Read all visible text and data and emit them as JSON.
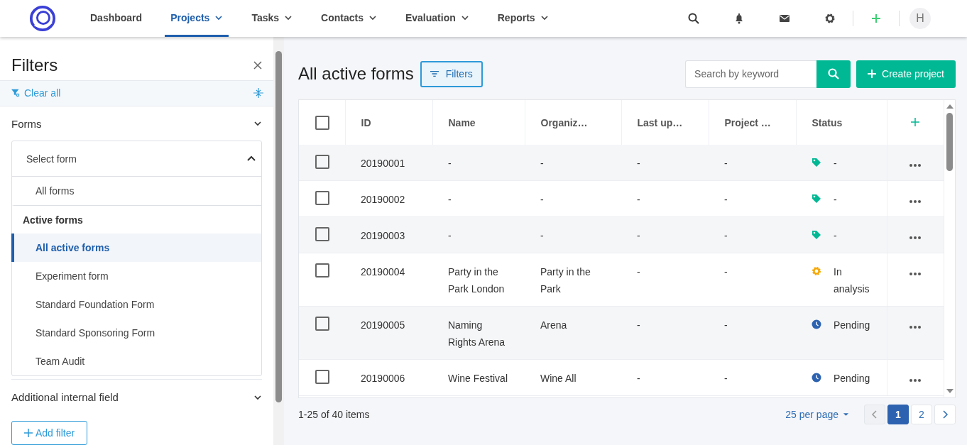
{
  "nav": {
    "items": [
      {
        "label": "Dashboard",
        "dropdown": false,
        "selected": false
      },
      {
        "label": "Projects",
        "dropdown": true,
        "selected": true
      },
      {
        "label": "Tasks",
        "dropdown": true,
        "selected": false
      },
      {
        "label": "Contacts",
        "dropdown": true,
        "selected": false
      },
      {
        "label": "Evaluation",
        "dropdown": true,
        "selected": false
      },
      {
        "label": "Reports",
        "dropdown": true,
        "selected": false
      }
    ],
    "avatar": "H"
  },
  "filters": {
    "title": "Filters",
    "clear_label": "Clear all",
    "forms_title": "Forms",
    "select": {
      "label": "Select form",
      "expanded": true
    },
    "options": [
      {
        "kind": "item",
        "label": "All forms",
        "selected": false
      },
      {
        "kind": "group",
        "label": "Active forms"
      },
      {
        "kind": "item",
        "label": "All active forms",
        "selected": true
      },
      {
        "kind": "item",
        "label": "Experiment form",
        "selected": false
      },
      {
        "kind": "item",
        "label": "Standard Foundation Form",
        "selected": false
      },
      {
        "kind": "item",
        "label": "Standard Sponsoring Form",
        "selected": false
      },
      {
        "kind": "item",
        "label": "Team Audit",
        "selected": false
      }
    ],
    "extra_title": "Additional internal field",
    "add_filter": "Add filter"
  },
  "main": {
    "title": "All active forms",
    "filter_button": "Filters",
    "search": {
      "placeholder": "Search by keyword"
    },
    "create_button": "Create project",
    "table": {
      "select_all": false,
      "columns": [
        "ID",
        "Name",
        "Organiz…",
        "Last up…",
        "Project …",
        "Status"
      ],
      "rows": [
        {
          "checked": false,
          "id": "20190001",
          "name": "-",
          "organization": "-",
          "last_updated": "-",
          "project": "-",
          "status": {
            "kind": "tag",
            "text": "-"
          }
        },
        {
          "checked": false,
          "id": "20190002",
          "name": "-",
          "organization": "-",
          "last_updated": "-",
          "project": "-",
          "status": {
            "kind": "tag",
            "text": "-"
          }
        },
        {
          "checked": false,
          "id": "20190003",
          "name": "-",
          "organization": "-",
          "last_updated": "-",
          "project": "-",
          "status": {
            "kind": "tag",
            "text": "-"
          }
        },
        {
          "checked": false,
          "id": "20190004",
          "name": "Party in the Park London",
          "organization": "Party in the Park",
          "last_updated": "-",
          "project": "-",
          "status": {
            "kind": "gear",
            "text": "In analysis"
          }
        },
        {
          "checked": false,
          "id": "20190005",
          "name": "Naming Rights Arena",
          "organization": "Arena",
          "last_updated": "-",
          "project": "-",
          "status": {
            "kind": "clock",
            "text": "Pending"
          }
        },
        {
          "checked": false,
          "id": "20190006",
          "name": "Wine Festival",
          "organization": "Wine All",
          "last_updated": "-",
          "project": "-",
          "status": {
            "kind": "clock",
            "text": "Pending"
          }
        }
      ]
    },
    "footer": {
      "summary": "1-25 of 40 items",
      "per_page": "25 per page",
      "pages": [
        {
          "label": "1",
          "selected": true
        },
        {
          "label": "2",
          "selected": false
        }
      ]
    }
  }
}
